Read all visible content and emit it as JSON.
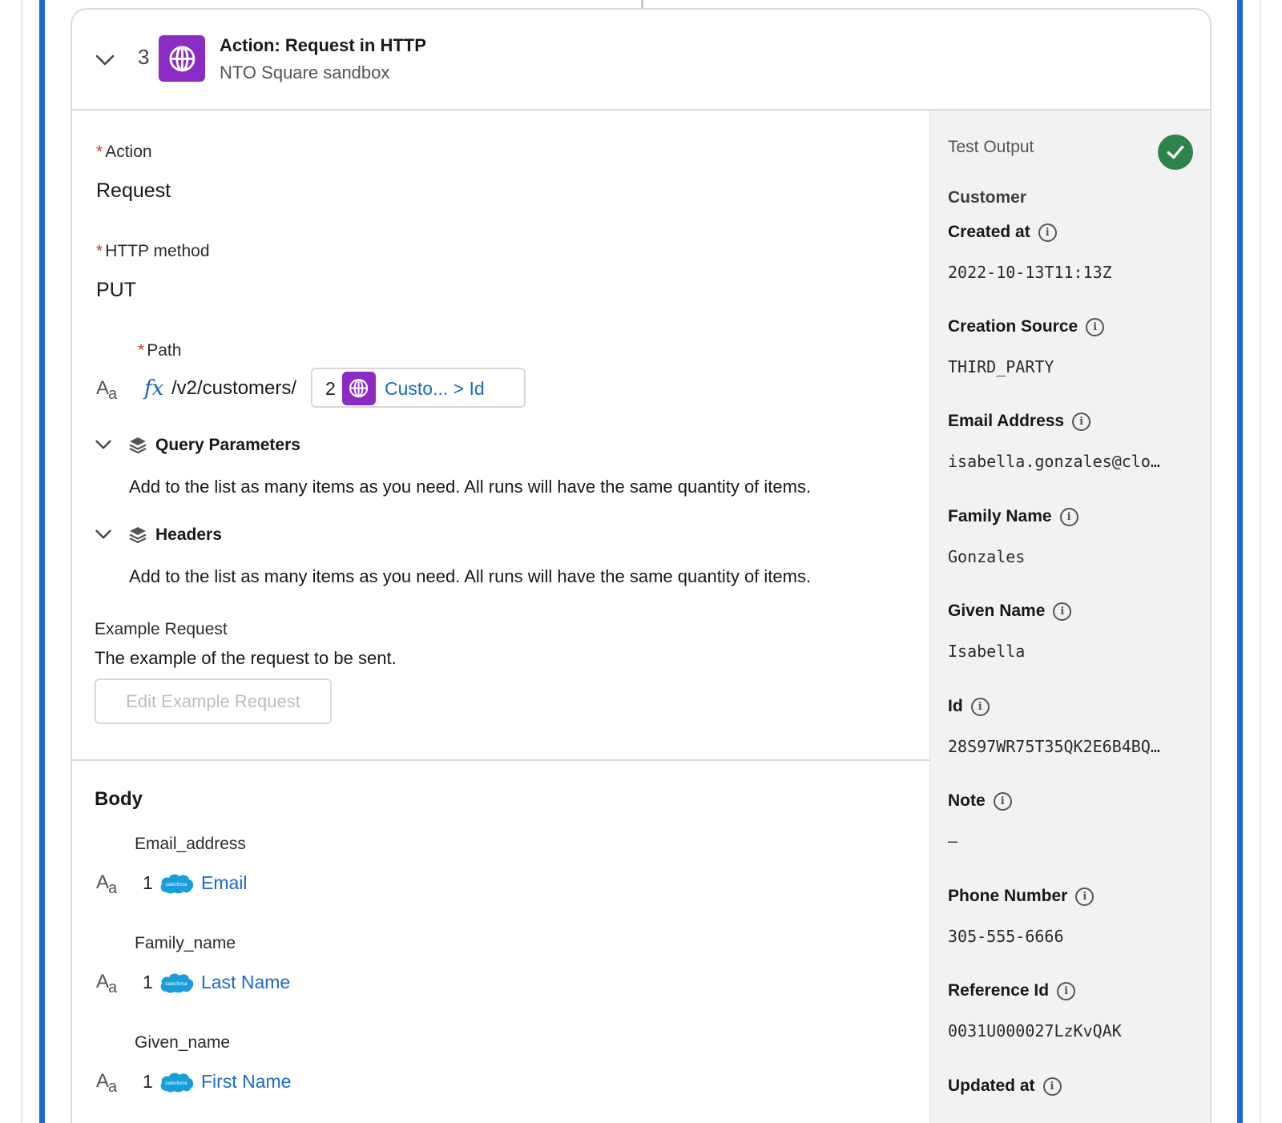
{
  "step": {
    "number": "3",
    "title": "Action: Request in HTTP",
    "subtitle": "NTO Square sandbox"
  },
  "form": {
    "required_mark": "*",
    "action_label": "Action",
    "action_value": "Request",
    "method_label": "HTTP method",
    "method_value": "PUT",
    "path_label": "Path",
    "path_type_icon": "Aa",
    "formula_icon": "fx",
    "path_text": "/v2/customers/",
    "path_token_step": "2",
    "path_token_label": "Custo... > Id",
    "query_title": "Query Parameters",
    "query_desc": "Add to the list as many items as you need. All runs will have the same quantity of items.",
    "headers_title": "Headers",
    "headers_desc": "Add to the list as many items as you need. All runs will have the same quantity of items.",
    "example_label": "Example Request",
    "example_desc": "The example of the request to be sent.",
    "edit_button": "Edit Example Request"
  },
  "body": {
    "title": "Body",
    "fields": [
      {
        "name": "Email_address",
        "step": "1",
        "value": "Email"
      },
      {
        "name": "Family_name",
        "step": "1",
        "value": "Last Name"
      },
      {
        "name": "Given_name",
        "step": "1",
        "value": "First Name"
      }
    ]
  },
  "output": {
    "title": "Test Output",
    "object": "Customer",
    "status_color": "#2e844a",
    "fields": [
      {
        "key": "Created at",
        "value": "2022-10-13T11:13Z"
      },
      {
        "key": "Creation Source",
        "value": "THIRD_PARTY"
      },
      {
        "key": "Email Address",
        "value": "isabella.gonzales@clo…"
      },
      {
        "key": "Family Name",
        "value": "Gonzales"
      },
      {
        "key": "Given Name",
        "value": "Isabella"
      },
      {
        "key": "Id",
        "value": "28S97WR75T35QK2E6B4BQ…"
      },
      {
        "key": "Note",
        "value": "–"
      },
      {
        "key": "Phone Number",
        "value": "305-555-6666"
      },
      {
        "key": "Reference Id",
        "value": "0031U000027LzKvQAK"
      },
      {
        "key": "Updated at",
        "value": ""
      }
    ]
  }
}
